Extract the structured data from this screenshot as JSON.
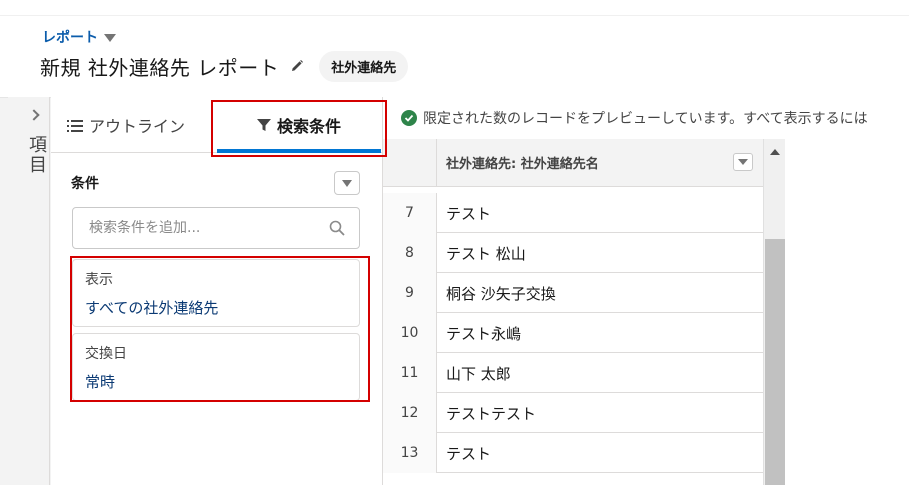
{
  "breadcrumb": {
    "label": "レポート"
  },
  "header": {
    "title": "新規 社外連絡先 レポート",
    "object_badge": "社外連絡先"
  },
  "rail": {
    "label": "項目"
  },
  "tabs": {
    "outline": "アウトライン",
    "filters": "検索条件"
  },
  "filters": {
    "section_title": "条件",
    "search_placeholder": "検索条件を追加...",
    "cards": [
      {
        "label": "表示",
        "value": "すべての社外連絡先"
      },
      {
        "label": "交換日",
        "value": "常時"
      }
    ]
  },
  "preview": {
    "notice": "限定された数のレコードをプレビューしています。すべて表示するには"
  },
  "table": {
    "column_header": "社外連絡先: 社外連絡先名",
    "rows": [
      {
        "num": "7",
        "name": "テスト"
      },
      {
        "num": "8",
        "name": "テスト 松山"
      },
      {
        "num": "9",
        "name": "桐谷 沙矢子交換"
      },
      {
        "num": "10",
        "name": "テスト永嶋"
      },
      {
        "num": "11",
        "name": "山下 太郎"
      },
      {
        "num": "12",
        "name": "テストテスト"
      },
      {
        "num": "13",
        "name": "テスト"
      }
    ]
  },
  "colors": {
    "accent": "#0176d3",
    "highlight": "#d40000",
    "link": "#0b5cab",
    "success": "#2e844a"
  }
}
